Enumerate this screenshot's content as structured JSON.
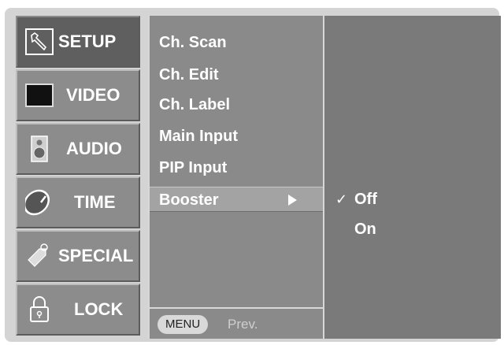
{
  "sidebar": {
    "items": [
      {
        "label": "SETUP",
        "icon": "wrench-icon"
      },
      {
        "label": "VIDEO",
        "icon": "screen-icon"
      },
      {
        "label": "AUDIO",
        "icon": "speaker-icon"
      },
      {
        "label": "TIME",
        "icon": "clock-icon"
      },
      {
        "label": "SPECIAL",
        "icon": "tag-icon"
      },
      {
        "label": "LOCK",
        "icon": "padlock-icon"
      }
    ],
    "active": "SETUP"
  },
  "menu": {
    "items": [
      "Ch. Scan",
      "Ch. Edit",
      "Ch. Label",
      "Main Input",
      "PIP Input",
      "Booster"
    ],
    "selected": "Booster",
    "menu_button": "MENU",
    "prev_label": "Prev."
  },
  "submenu": {
    "options": [
      "Off",
      "On"
    ],
    "checked": "Off",
    "check_mark": "✓"
  },
  "colors": {
    "frame": "#d4d4d4",
    "sidebar_item": "#8c8c8c",
    "menu_panel": "#8a8a8a",
    "sub_panel": "#7a7a7a",
    "text": "#ffffff"
  }
}
